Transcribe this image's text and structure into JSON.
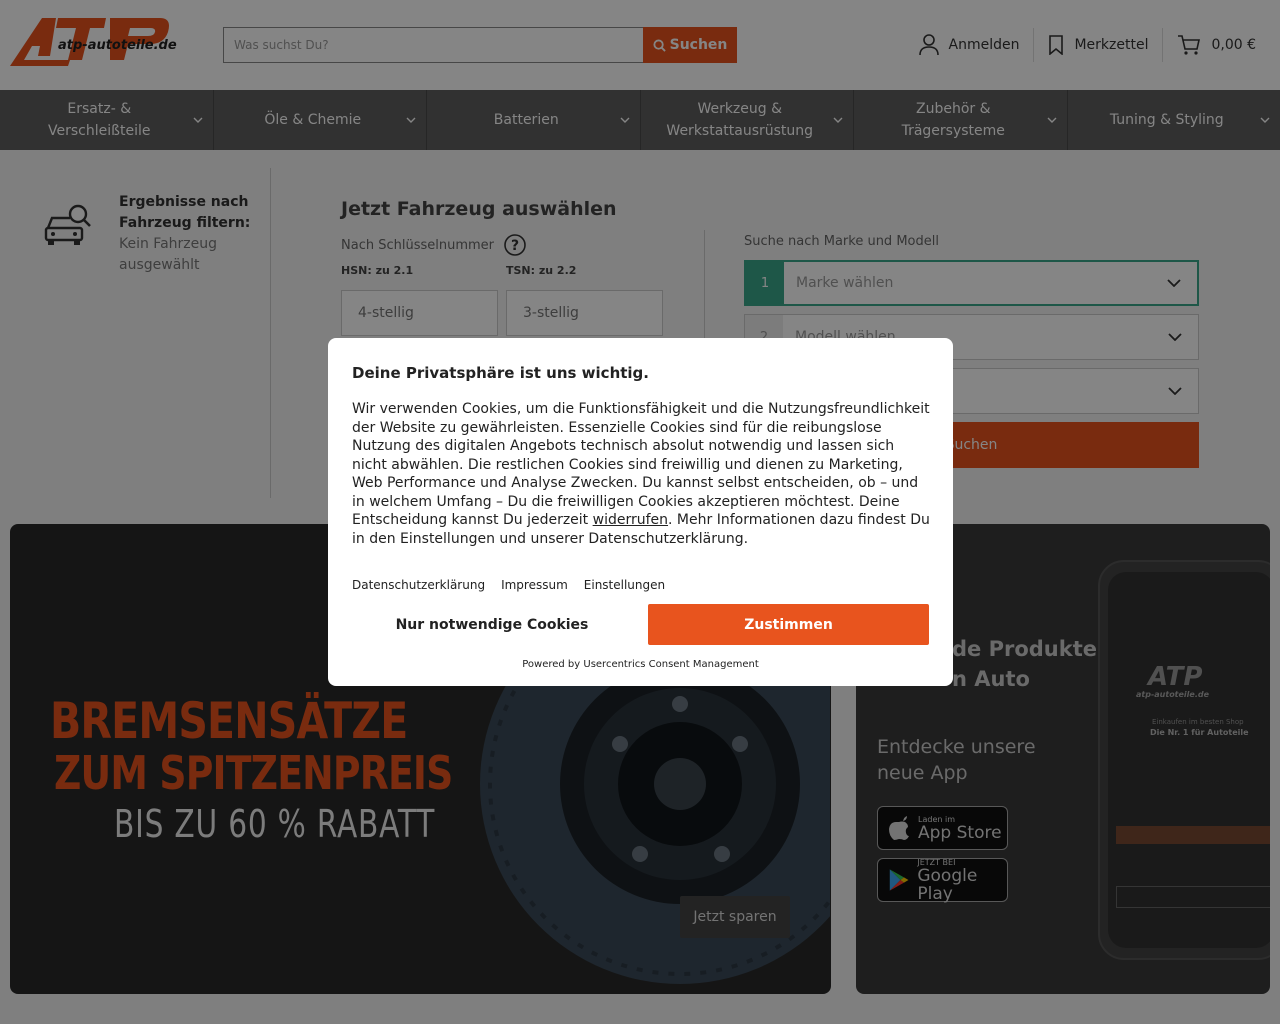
{
  "header": {
    "logo_text": "atp-autoteile.de",
    "search_placeholder": "Was suchst Du?",
    "search_button": "Suchen",
    "login": "Anmelden",
    "wishlist": "Merkzettel",
    "cart_total": "0,00 €"
  },
  "nav": [
    {
      "line1": "Ersatz- &",
      "line2": "Verschleißteile"
    },
    {
      "line1": "Öle & Chemie",
      "line2": ""
    },
    {
      "line1": "Batterien",
      "line2": ""
    },
    {
      "line1": "Werkzeug &",
      "line2": "Werkstattausrüstung"
    },
    {
      "line1": "Zubehör &",
      "line2": "Trägersysteme"
    },
    {
      "line1": "Tuning & Styling",
      "line2": ""
    }
  ],
  "filter": {
    "title_line1": "Ergebnisse nach",
    "title_line2": "Fahrzeug filtern:",
    "status_line1": "Kein Fahrzeug",
    "status_line2": "ausgewählt"
  },
  "vehicle": {
    "title": "Jetzt Fahrzeug auswählen",
    "key_label": "Nach Schlüsselnummer",
    "hsn_label": "HSN: zu 2.1",
    "tsn_label": "TSN: zu 2.2",
    "hsn_placeholder": "4-stellig",
    "tsn_placeholder": "3-stellig",
    "model_label": "Suche nach Marke und Modell",
    "step1_num": "1",
    "step1_text": "Marke wählen",
    "step2_num": "2",
    "step2_text": "Modell wählen",
    "search_button": "Suchen"
  },
  "banner_left": {
    "line1": "BREMSENSÄTZE",
    "line2": "ZUM SPITZENPREIS",
    "line3": "BIS ZU 60 % RABATT",
    "cta": "Jetzt sparen"
  },
  "banner_right": {
    "products_line1": "de Produkte",
    "products_line2": "n Auto",
    "app_line1": "Entdecke unsere",
    "app_line2": "neue App",
    "appstore_small": "Laden im",
    "appstore_large": "App Store",
    "googleplay_small": "JETZT BEI",
    "googleplay_large": "Google Play",
    "phone_logo": "ATP",
    "phone_sub": "atp-autoteile.de",
    "phone_t1": "Einkaufen im besten Shop",
    "phone_t2": "Die Nr. 1 für Autoteile"
  },
  "consent": {
    "title": "Deine Privatsphäre ist uns wichtig.",
    "body_before": "Wir verwenden Cookies, um die Funktionsfähigkeit und die Nutzungsfreundlichkeit der Website zu gewährleisten. Essenzielle Cookies sind für die reibungslose Nutzung des digitalen Angebots technisch absolut notwendig und lassen sich nicht abwählen. Die restlichen Cookies sind freiwillig und dienen zu Marketing, Web Performance und Analyse Zwecken. Du kannst selbst entscheiden, ob – und in welchem Umfang – Du die freiwilligen Cookies akzeptieren möchtest. Deine Entscheidung kannst Du jederzeit ",
    "body_link": "widerrufen",
    "body_after": ". Mehr Informationen dazu findest Du in den Einstellungen und unserer Datenschutzerklärung.",
    "link_privacy": "Datenschutzerklärung",
    "link_imprint": "Impressum",
    "link_settings": "Einstellungen",
    "btn_necessary": "Nur notwendige Cookies",
    "btn_accept": "Zustimmen",
    "powered": "Powered by Usercentrics Consent Management"
  },
  "colors": {
    "accent": "#e8541e",
    "nav_bg": "#5e5e5e",
    "step_active": "#3aa88a"
  }
}
